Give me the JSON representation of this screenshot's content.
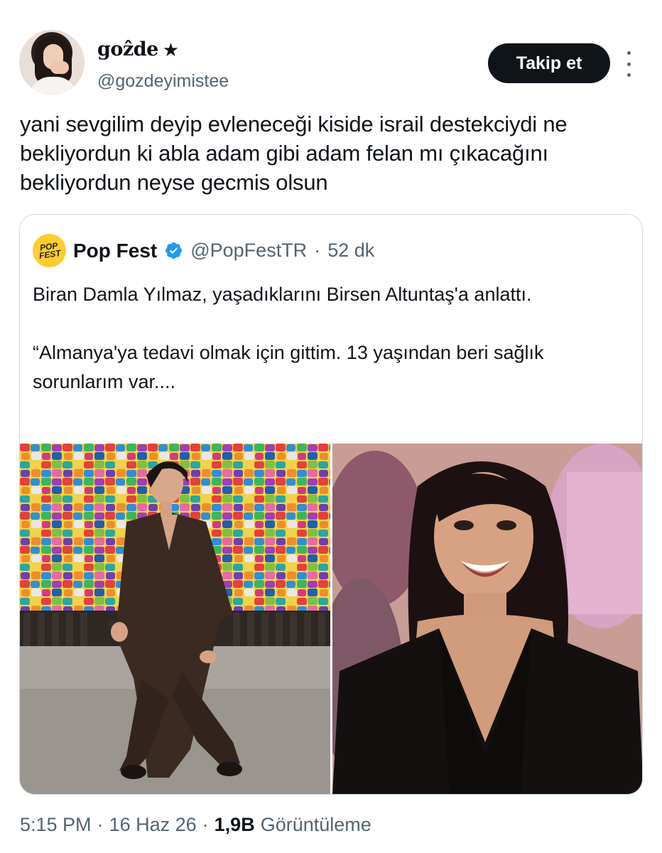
{
  "author": {
    "display_name": "goẑde",
    "name_badge": "★",
    "handle": "@gozdeyimistee",
    "avatar_icon": "user-avatar"
  },
  "actions": {
    "follow_label": "Takip et",
    "more_icon": "more-vertical-icon"
  },
  "tweet": {
    "text": "yani sevgilim deyip evleneceği kiside israil destekciydi ne bekliyordun ki abla adam gibi adam felan mı çıkacağını bekliyordun neyse gecmis olsun"
  },
  "quoted": {
    "logo_line1": "POP",
    "logo_line2": "FEST",
    "name": "Pop Fest",
    "verified_icon": "verified-badge-icon",
    "handle": "@PopFestTR",
    "separator": "·",
    "time": "52 dk",
    "paragraph1": "Biran Damla Yılmaz, yaşadıklarını Birsen Altuntaş'a anlattı.",
    "paragraph2": "“Almanya'ya tedavi olmak için gittim. 13 yaşından beri sağlık sorunlarım var....",
    "colors": {
      "logo": "#ffcc2e",
      "verified": "#1d9bf0"
    }
  },
  "meta": {
    "time": "5:15 PM",
    "sep1": "·",
    "date": "16 Haz 26",
    "sep2": "·",
    "views_count": "1,9B",
    "views_label": "Görüntüleme"
  },
  "colors": {
    "text": "#0f1419",
    "secondary": "#536471",
    "border": "#cfd9de",
    "button": "#0f1419"
  }
}
